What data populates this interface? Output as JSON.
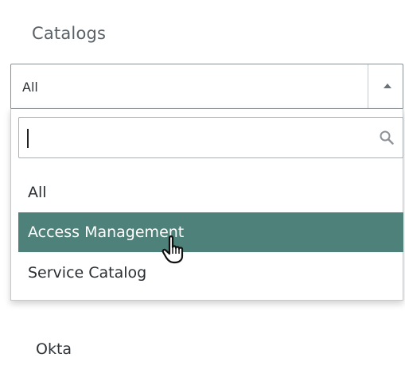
{
  "panel": {
    "title": "Catalogs"
  },
  "select": {
    "value": "All"
  },
  "dropdown": {
    "search": {
      "value": "",
      "placeholder": ""
    },
    "options": [
      {
        "label": "All",
        "highlighted": false
      },
      {
        "label": "Access Management",
        "highlighted": true
      },
      {
        "label": "Service Catalog",
        "highlighted": false
      }
    ]
  },
  "list": {
    "items": [
      {
        "label": "Okta"
      }
    ]
  },
  "colors": {
    "highlight": "#4e8179",
    "border": "#8a9094",
    "text": "#2e3338"
  },
  "icons": {
    "search": "search-icon",
    "arrow": "caret-up-icon",
    "cursor": "hand-pointer-icon"
  }
}
